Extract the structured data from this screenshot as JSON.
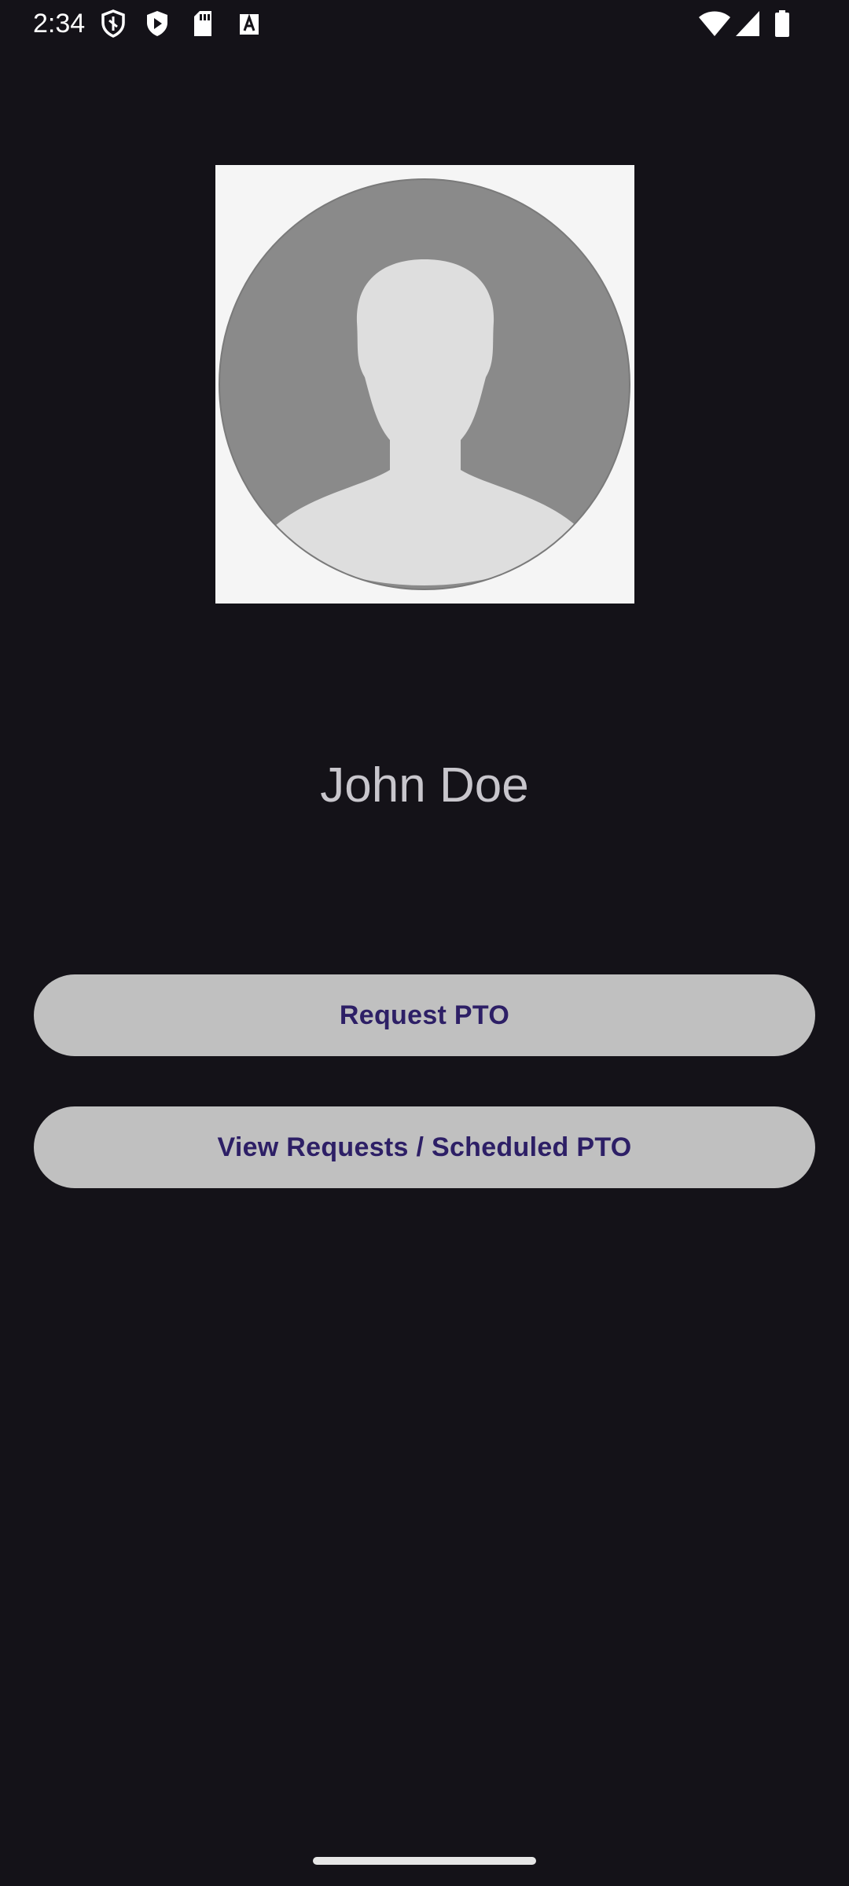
{
  "status_bar": {
    "time": "2:34",
    "left_icons": [
      "shield-icon",
      "play-store-icon",
      "sd-card-icon",
      "keyboard-a-icon"
    ],
    "right_icons": [
      "wifi-icon",
      "cellular-signal-icon",
      "battery-icon"
    ]
  },
  "profile": {
    "avatar_icon": "default-user-avatar-icon",
    "name": "John Doe"
  },
  "actions": {
    "request_pto_label": "Request PTO",
    "view_requests_label": "View Requests / Scheduled PTO"
  },
  "colors": {
    "background": "#141218",
    "button_background": "#c0c0c0",
    "button_text": "#2d1f66",
    "name_text": "#c8c6cc"
  }
}
